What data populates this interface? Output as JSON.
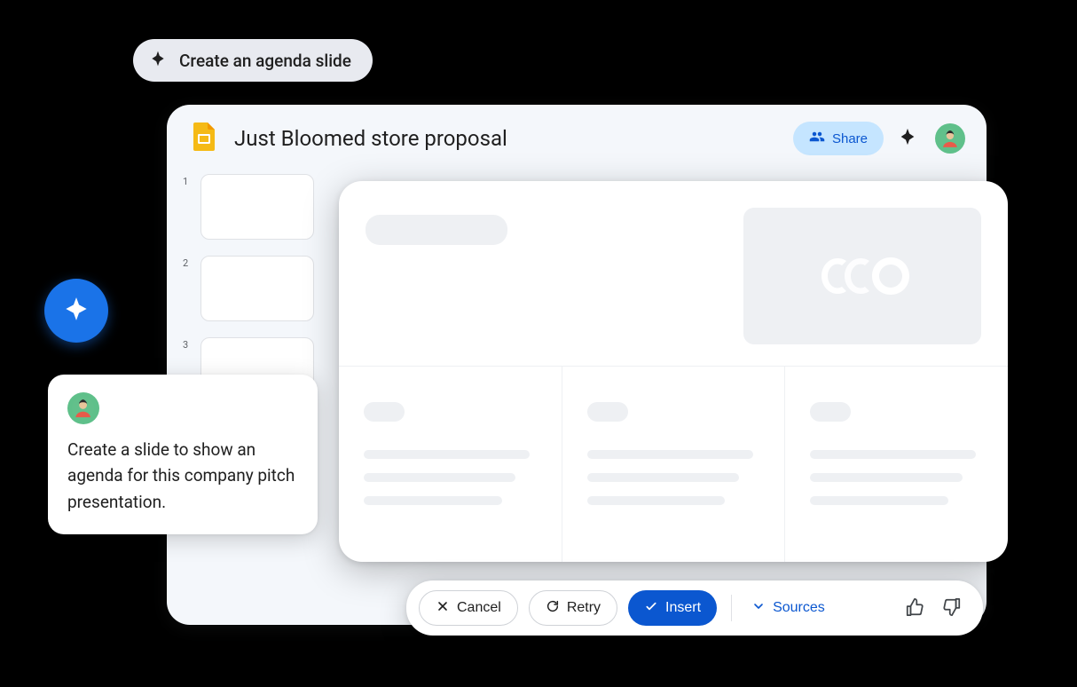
{
  "chip": {
    "label": "Create an agenda slide"
  },
  "doc": {
    "title": "Just Bloomed store proposal"
  },
  "header": {
    "share_label": "Share"
  },
  "thumbs": {
    "n1": "1",
    "n2": "2",
    "n3": "3"
  },
  "actions": {
    "cancel": "Cancel",
    "retry": "Retry",
    "insert": "Insert",
    "sources": "Sources"
  },
  "prompt": {
    "text": "Create a slide to show an agenda for this company pitch presentation."
  }
}
